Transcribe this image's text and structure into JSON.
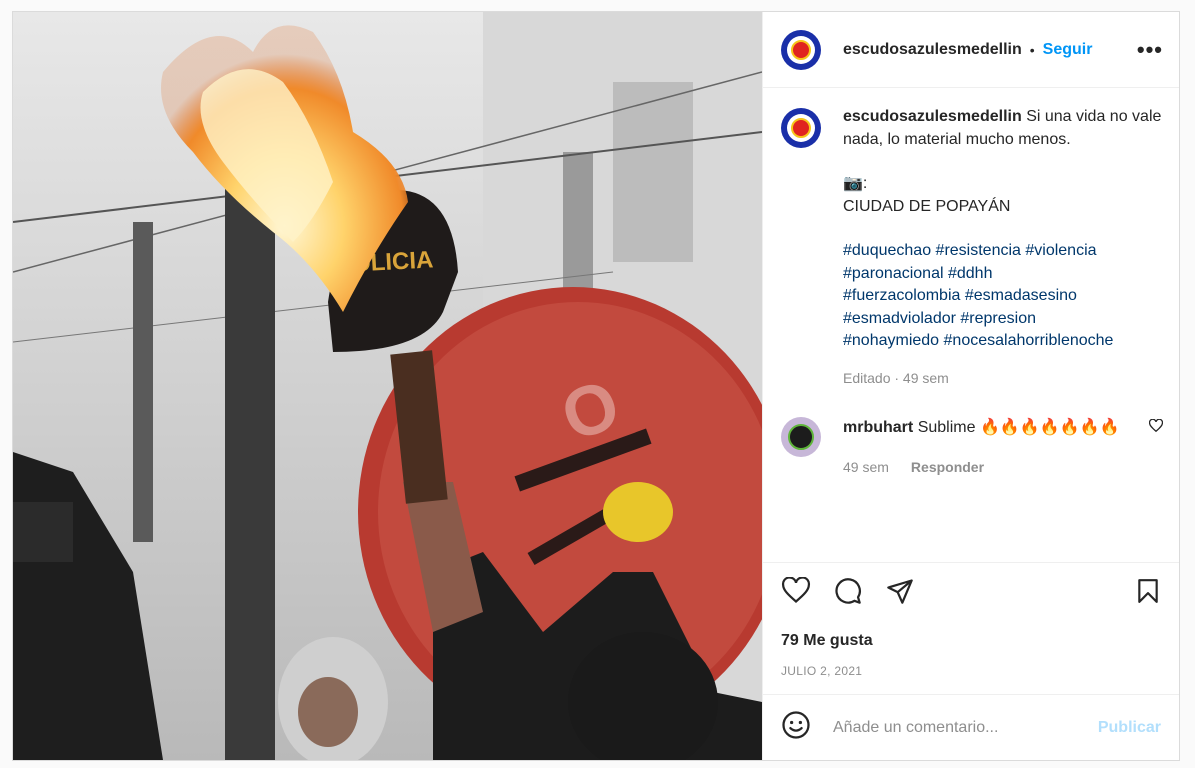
{
  "post": {
    "image_alt": "Photo of protester holding a burning police cap on a stick in front of a red round shield",
    "cap_text": "POLICIA",
    "author": {
      "username": "escudosazulesmedellin",
      "follow_label": "Seguir",
      "separator": "•",
      "more_label": "•••"
    },
    "caption": {
      "text_line1": "Si una vida no vale nada, lo material mucho menos.",
      "camera_line": "📷:",
      "location_line": "CIUDAD DE POPAYÁN",
      "hashtags": [
        "#duquechao",
        "#resistencia",
        "#violencia",
        "#paronacional",
        "#ddhh",
        "#fuerzacolombia",
        "#esmadasesino",
        "#esmadviolador",
        "#represion",
        "#nohaymiedo",
        "#nocesalahorriblenoche"
      ],
      "meta": "Editado · 49 sem"
    },
    "comments": [
      {
        "username": "mrbuhart",
        "text": "Sublime 🔥🔥🔥🔥🔥🔥🔥",
        "time": "49 sem",
        "reply_label": "Responder"
      }
    ],
    "likes": "79 Me gusta",
    "date": "JULIO 2, 2021",
    "add_comment": {
      "placeholder": "Añade un comentario...",
      "publish_label": "Publicar"
    }
  },
  "colors": {
    "link_blue": "#0095f6",
    "hashtag": "#00376b",
    "muted": "#8e8e8e",
    "publish_disabled": "#b2dffc"
  }
}
